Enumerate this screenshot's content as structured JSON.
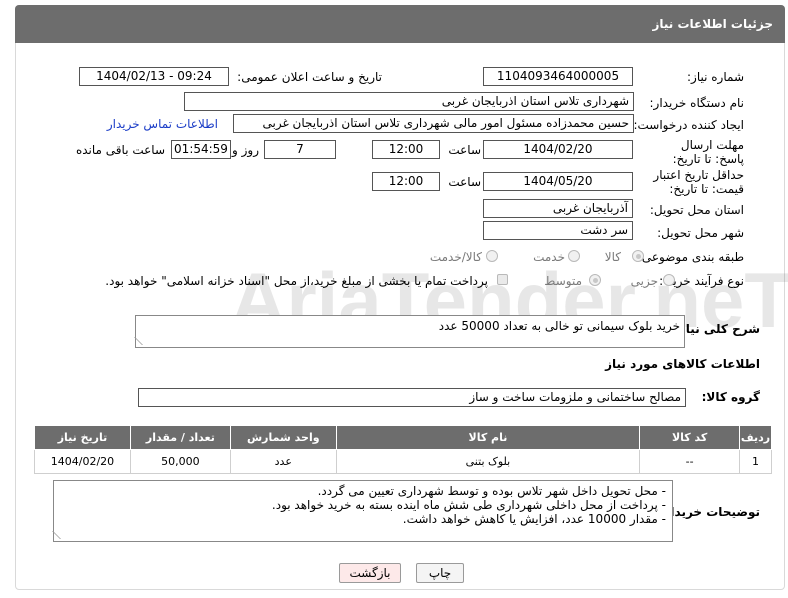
{
  "header": {
    "title": "جزئیات اطلاعات نیاز"
  },
  "fields": {
    "need_number_label": "شماره نیاز:",
    "need_number": "1104093464000005",
    "announce_label": "تاریخ و ساعت اعلان عمومی:",
    "announce_value": "1404/02/13 - 09:24",
    "buyer_org_label": "نام دستگاه خریدار:",
    "buyer_org": "شهرداری تلاس استان اذربایجان غربی",
    "requester_label": "ایجاد کننده درخواست:",
    "requester": "حسین محمدزاده مسئول امور مالی شهرداری تلاس استان اذربایجان غربی",
    "buyer_contact_link": "اطلاعات تماس خریدار",
    "reply_deadline_label": "مهلت ارسال پاسخ: تا تاریخ:",
    "reply_date": "1404/02/20",
    "time_label": "ساعت",
    "reply_time": "12:00",
    "days_value": "7",
    "days_label": "روز و",
    "remaining_time": "01:54:59",
    "remaining_label": "ساعت باقی مانده",
    "price_validity_label": "حداقل تاریخ اعتبار قیمت: تا تاریخ:",
    "price_date": "1404/05/20",
    "price_time": "12:00",
    "delivery_province_label": "استان محل تحویل:",
    "delivery_province": "آذربایجان غربی",
    "delivery_city_label": "شهر محل تحویل:",
    "delivery_city": "سر دشت",
    "category_label": "طبقه بندی موضوعی:",
    "category_options": [
      "کالا",
      "خدمت",
      "کالا/خدمت"
    ],
    "category_selected": "کالا",
    "process_label": "نوع فرآیند خرید :",
    "process_options": [
      "جزیی",
      "متوسط"
    ],
    "process_selected": "متوسط",
    "payment_note": "پرداخت تمام یا بخشی از مبلغ خرید،از محل \"اسناد خزانه اسلامی\" خواهد بود.",
    "description_label": "شرح کلی نیاز:",
    "description": "خرید بلوک سیمانی  تو خالی به تعداد 50000 عدد",
    "goods_info_title": "اطلاعات کالاهای مورد نیاز",
    "goods_group_label": "گروه کالا:",
    "goods_group": "مصالح ساختمانی و ملزومات ساخت و ساز",
    "buyer_notes_label": "توضیحات خریدار:",
    "buyer_notes": [
      "-     محل تحویل داخل شهر تلاس بوده و توسط شهرداری تعیین می گردد.",
      "-     پرداخت از محل داخلی شهرداری  طی شش ماه اینده بسته به خرید خواهد بود.",
      "-     مقدار 10000 عدد، افزایش یا کاهش خواهد داشت."
    ]
  },
  "table": {
    "headers": [
      "ردیف",
      "کد کالا",
      "نام کالا",
      "واحد شمارش",
      "تعداد / مقدار",
      "تاریخ نیاز"
    ],
    "rows": [
      [
        "1",
        "--",
        "بلوک بتنی",
        "عدد",
        "50,000",
        "1404/02/20"
      ]
    ]
  },
  "buttons": {
    "print": "چاپ",
    "back": "بازگشت"
  },
  "watermark": "AriaTender.neT",
  "colors": {
    "header_bg": "#6d6d6d",
    "link": "#1a3cc7",
    "back_bg": "#fde9e9"
  }
}
